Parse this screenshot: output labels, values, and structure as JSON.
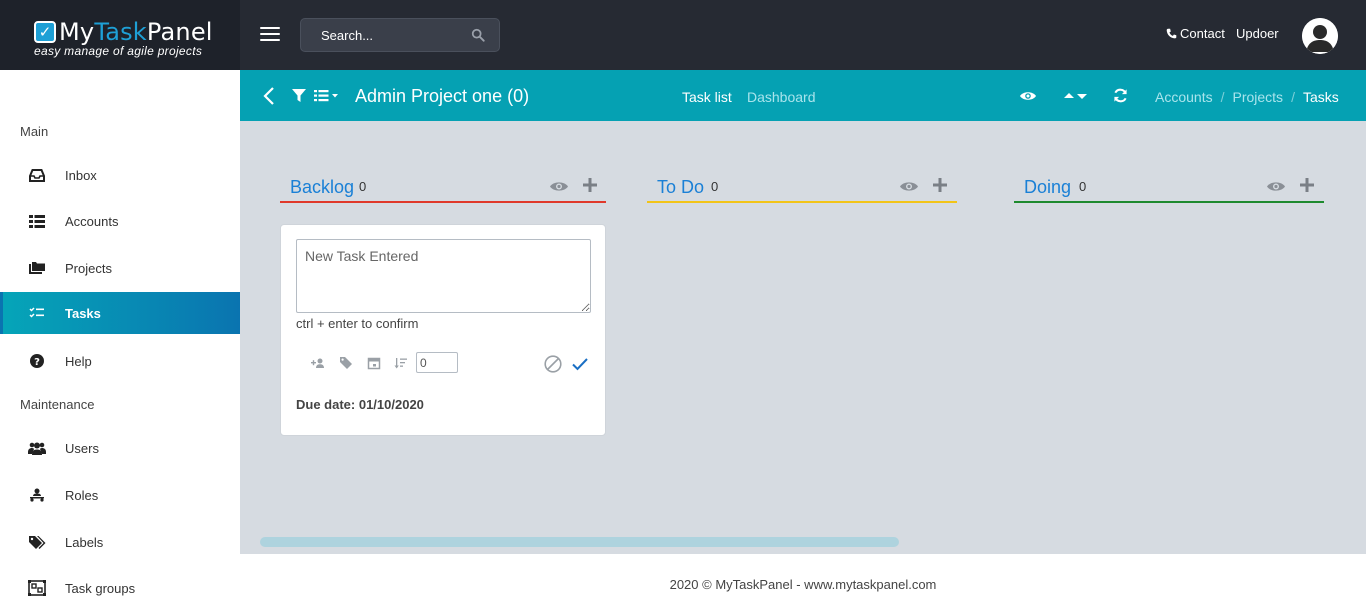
{
  "brand": {
    "name_part1": "My",
    "name_part2": "Task",
    "name_part3": "Panel",
    "tagline": "easy manage of agile projects",
    "accent": "#1ea0d6"
  },
  "topbar": {
    "search_placeholder": "Search...",
    "contact_label": "Contact",
    "user_name": "Updoer"
  },
  "sidebar": {
    "heading_main": "Main",
    "heading_maintenance": "Maintenance",
    "items": [
      {
        "label": "Inbox",
        "icon": "inbox-icon"
      },
      {
        "label": "Accounts",
        "icon": "list-icon"
      },
      {
        "label": "Projects",
        "icon": "folders-icon"
      },
      {
        "label": "Tasks",
        "icon": "tasks-icon",
        "active": true
      },
      {
        "label": "Help",
        "icon": "help-icon"
      },
      {
        "label": "Users",
        "icon": "users-icon"
      },
      {
        "label": "Roles",
        "icon": "roles-icon"
      },
      {
        "label": "Labels",
        "icon": "labels-icon"
      },
      {
        "label": "Task groups",
        "icon": "task-groups-icon"
      }
    ]
  },
  "subbar": {
    "project_title": "Admin Project one (0)",
    "tab_tasklist": "Task list",
    "tab_dashboard": "Dashboard",
    "breadcrumb": {
      "accounts": "Accounts",
      "projects": "Projects",
      "tasks": "Tasks",
      "separator": "/"
    }
  },
  "columns": [
    {
      "title": "Backlog",
      "count": "0",
      "color": "#e0392b"
    },
    {
      "title": "To Do",
      "count": "0",
      "color": "#f2c418"
    },
    {
      "title": "Doing",
      "count": "0",
      "color": "#1e8a2e"
    }
  ],
  "new_task_card": {
    "textarea_value": "New Task Entered",
    "hint": "ctrl + enter to confirm",
    "estimate_value": "0",
    "due_date": "Due date: 01/10/2020"
  },
  "footer": {
    "text": "2020 © MyTaskPanel - www.mytaskpanel.com"
  }
}
